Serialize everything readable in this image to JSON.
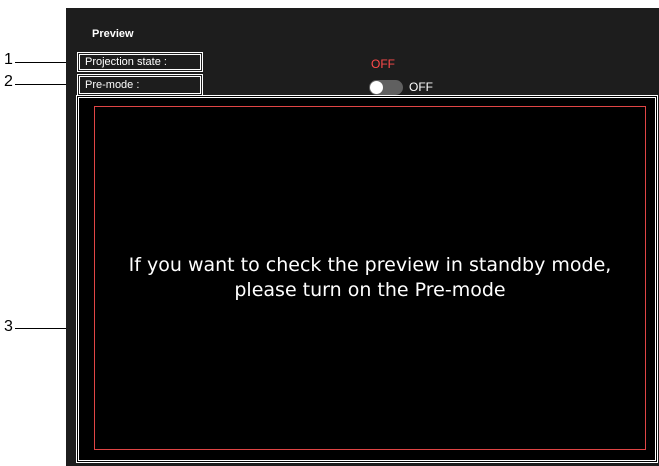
{
  "panel": {
    "title": "Preview"
  },
  "fields": {
    "projection_state_label": "Projection state :",
    "projection_state_value": "OFF",
    "premode_label": "Pre-mode :",
    "premode_toggle_text": "OFF",
    "premode_enabled": false
  },
  "preview": {
    "message_line1": "If you want to check the preview in standby mode,",
    "message_line2": "please turn on the Pre-mode"
  },
  "callouts": {
    "c1": "1",
    "c2": "2",
    "c3": "3"
  },
  "colors": {
    "panel_bg": "#1d1d1d",
    "off_state": "#ff4a4a",
    "preview_border": "#e04545"
  }
}
